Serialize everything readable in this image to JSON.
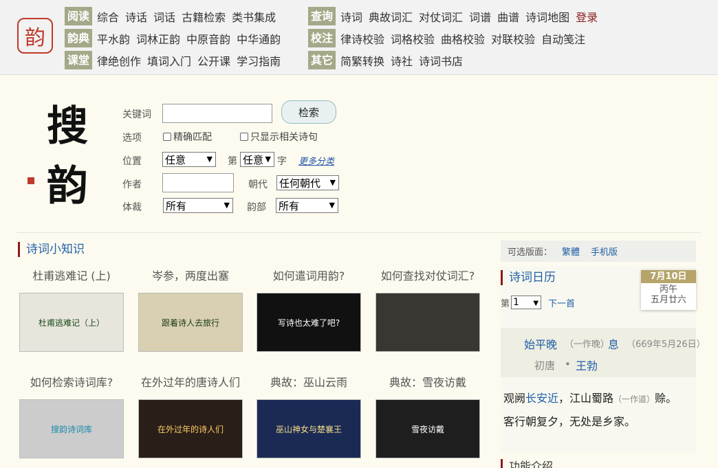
{
  "nav": {
    "logo_text": "韵",
    "rows": [
      {
        "cat": "阅读",
        "links": [
          "综合",
          "诗话",
          "词话",
          "古籍检索",
          "类书集成"
        ]
      },
      {
        "cat": "韵典",
        "links": [
          "平水韵",
          "词林正韵",
          "中原音韵",
          "中华通韵"
        ]
      },
      {
        "cat": "课堂",
        "links": [
          "律绝创作",
          "填词入门",
          "公开课",
          "学习指南"
        ]
      }
    ],
    "rows2": [
      {
        "cat": "查询",
        "links": [
          "诗词",
          "典故词汇",
          "对仗词汇",
          "词谱",
          "曲谱",
          "诗词地图"
        ],
        "login": "登录"
      },
      {
        "cat": "校注",
        "links": [
          "律诗校验",
          "词格校验",
          "曲格校验",
          "对联校验",
          "自动笺注"
        ]
      },
      {
        "cat": "其它",
        "links": [
          "简繁转换",
          "诗社",
          "诗词书店"
        ]
      }
    ]
  },
  "brand": {
    "char1": "搜",
    "char2": "韵"
  },
  "search": {
    "keyword_label": "关键词",
    "search_button": "检索",
    "options_label": "选项",
    "exact_match": "精确匹配",
    "only_related": "只显示相关诗句",
    "position_label": "位置",
    "position_value": "任意",
    "nth_label": "第",
    "nth_value": "任意",
    "char_label": "字",
    "more_categories": "更多分类",
    "author_label": "作者",
    "dynasty_label": "朝代",
    "dynasty_value": "任何朝代",
    "genre_label": "体裁",
    "genre_value": "所有",
    "rhyme_label": "韵部",
    "rhyme_value": "所有"
  },
  "knowledge": {
    "title": "诗词小知识",
    "cards": [
      {
        "title": "杜甫逃难记 (上)",
        "caption": "杜甫逃难记（上）",
        "bg": "#e7e5dc",
        "fg": "#1a4a1a"
      },
      {
        "title": "岑参，两度出塞",
        "caption": "跟着诗人去旅行",
        "bg": "#d8d0b0",
        "fg": "#1a3a1a"
      },
      {
        "title": "如何遣词用韵?",
        "caption": "写诗也太难了吧?",
        "bg": "#111111",
        "fg": "#ffffff"
      },
      {
        "title": "如何查找对仗词汇?",
        "caption": "",
        "bg": "#3a3632",
        "fg": "#e8c680"
      },
      {
        "title": "如何检索诗词库?",
        "caption": "搜韵诗词库",
        "bg": "#cccccc",
        "fg": "#1a8aaa"
      },
      {
        "title": "在外过年的唐诗人们",
        "caption": "在外过年的诗人们",
        "bg": "#2a1f18",
        "fg": "#ffcc66"
      },
      {
        "title": "典故：巫山云雨",
        "caption": "巫山神女与楚襄王",
        "bg": "#1b2a55",
        "fg": "#f5e08a"
      },
      {
        "title": "典故：雪夜访戴",
        "caption": "雪夜访戴",
        "bg": "#1e1e1e",
        "fg": "#ffffff"
      }
    ]
  },
  "sidebar": {
    "versions_label": "可选版面：",
    "versions": [
      "繁體",
      "手机版"
    ],
    "calendar_title": "诗词日历",
    "date_main": "7月10日",
    "date_ganzhi": "丙午",
    "date_lunar": "五月廿六",
    "page_prefix": "第",
    "page_value": "1",
    "next_page": "下一首",
    "poem_title": "始平晚",
    "poem_title_alt": "（一作晚）",
    "poem_title_end": "息",
    "poem_date": "（669年5月26日）",
    "poem_era": "初唐",
    "poem_author": "王勃",
    "line1_a": "观阙",
    "line1_place": "长安近",
    "line1_b": "，江山蜀路",
    "line1_alt": "（一作道）",
    "line1_c": "赊。",
    "line2": "客行朝复夕，无处是乡家。",
    "func_title": "功能介绍"
  }
}
